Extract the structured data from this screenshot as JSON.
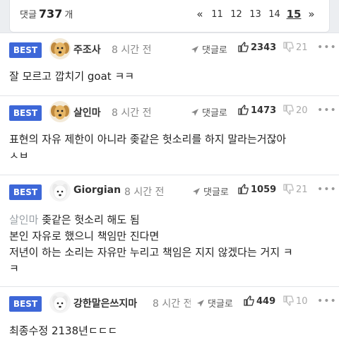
{
  "header": {
    "count_prefix": "댓글",
    "count_value": "737",
    "count_suffix": "개",
    "pager": {
      "prev": "«",
      "pages": [
        "11",
        "12",
        "13",
        "14"
      ],
      "current": "15",
      "next": "»"
    }
  },
  "comments": [
    {
      "badge": "BEST",
      "nick": "주조사",
      "time": "8 시간 전",
      "reply_label": "댓글로",
      "likes": "2343",
      "dislikes": "21",
      "more": "•••",
      "text_lines": [
        "잘 모르고 깝치기 goat ㅋㅋ"
      ]
    },
    {
      "badge": "BEST",
      "nick": "살인마",
      "time": "8 시간 전",
      "reply_label": "댓글로",
      "likes": "1473",
      "dislikes": "20",
      "more": "•••",
      "text_lines": [
        "표현의 자유 제한이 아니라 좆같은 헛소리를 하지 말라는거잖아",
        "ㅅㅂ"
      ]
    },
    {
      "badge": "BEST",
      "nick": "Giorgian",
      "time": "8 시간 전",
      "reply_label": "댓글로",
      "likes": "1059",
      "dislikes": "21",
      "more": "•••",
      "quote": "살인마",
      "text_lines": [
        "좆같은 헛소리 해도 됨",
        "본인 자유로 했으니 책임만 진다면",
        "저년이 하는 소리는 자유만 누리고 책임은 지지 않겠다는 거지 ㅋ",
        "ㅋ"
      ]
    },
    {
      "badge": "BEST",
      "nick": "강한말은쓰지마",
      "time": "8 시간 전",
      "reply_label": "댓글로",
      "likes": "449",
      "dislikes": "10",
      "more": "•••",
      "text_lines": [
        "최종수정 2138년ㄷㄷㄷ"
      ]
    }
  ],
  "colors": {
    "best_badge": "#3d67d8",
    "background": "#eceef1"
  },
  "icons": [
    "dog-avatar-icon",
    "white-dog-avatar-icon",
    "send-arrow-icon",
    "thumbs-up-icon",
    "thumbs-down-icon",
    "more-dots-icon"
  ]
}
